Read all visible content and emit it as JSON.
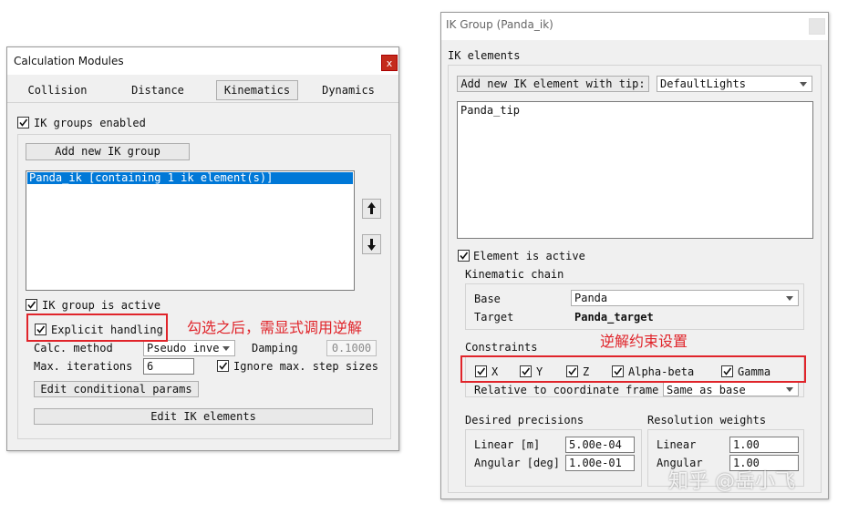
{
  "left_window": {
    "title": "Calculation Modules",
    "close": "x",
    "tabs": [
      "Collision",
      "Distance",
      "Kinematics",
      "Dynamics"
    ],
    "ik_groups_enabled": "IK groups enabled",
    "add_group": "Add new IK group",
    "groups": [
      "Panda_ik [containing 1 ik element(s)]"
    ],
    "group_active": "IK group is active",
    "explicit": "Explicit handling",
    "calc_method_label": "Calc. method",
    "calc_method_value": "Pseudo inve",
    "damping_label": "Damping",
    "damping_value": "0.1000",
    "max_iter_label": "Max. iterations",
    "max_iter_value": "6",
    "ignore_max": "Ignore max. step sizes",
    "edit_cond": "Edit conditional params",
    "edit_ik": "Edit IK elements",
    "annotation": "勾选之后，需显式调用逆解"
  },
  "right_window": {
    "title": "IK Group (Panda_ik)",
    "ik_elements": "IK elements",
    "add_element": "Add new IK element with tip:",
    "tip_value": "DefaultLights",
    "elements": [
      "Panda_tip"
    ],
    "element_active": "Element is active",
    "kinematic_chain": "Kinematic chain",
    "base_label": "Base",
    "base_value": "Panda",
    "target_label": "Target",
    "target_value": "Panda_target",
    "constraints": "Constraints",
    "c_x": "X",
    "c_y": "Y",
    "c_z": "Z",
    "c_ab": "Alpha-beta",
    "c_g": "Gamma",
    "relative_label": "Relative to coordinate frame",
    "relative_value": "Same as base",
    "annotation": "逆解约束设置",
    "desired_prec": "Desired precisions",
    "linear_m": "Linear [m]",
    "linear_m_value": "5.00e-04",
    "angular_deg": "Angular [deg]",
    "angular_deg_value": "1.00e-01",
    "res_weights": "Resolution weights",
    "linear": "Linear",
    "linear_w": "1.00",
    "angular": "Angular",
    "angular_w": "1.00"
  },
  "watermark": "知乎 @岳小飞",
  "colors": {
    "accent": "#0078d7",
    "annotation": "#e0242a",
    "close": "#c42b1c"
  }
}
